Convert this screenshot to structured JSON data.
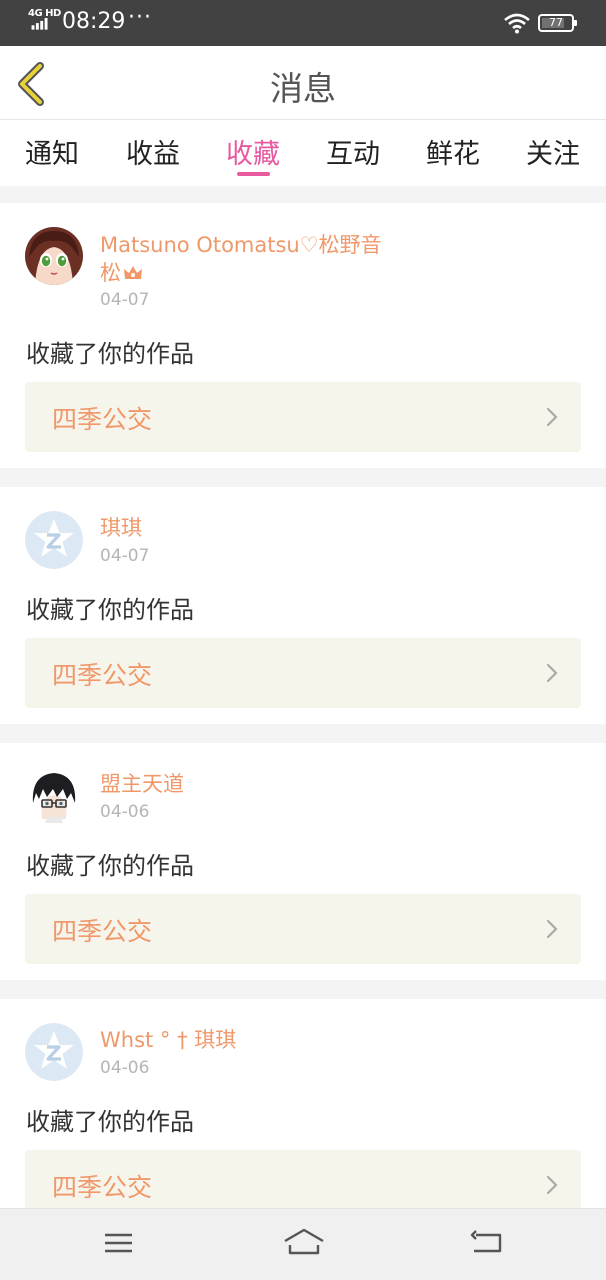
{
  "status_bar": {
    "network": "4G HD",
    "time": "08:29",
    "more": "···",
    "battery": "77",
    "battery_level": 0.77
  },
  "header": {
    "title": "消息",
    "back_icon": "chevron-left-icon"
  },
  "tabs": [
    {
      "label": "通知"
    },
    {
      "label": "收益"
    },
    {
      "label": "收藏",
      "active": true
    },
    {
      "label": "互动"
    },
    {
      "label": "鲜花"
    },
    {
      "label": "关注"
    }
  ],
  "messages": [
    {
      "user": "Matsuno Otomatsu♡松野音松",
      "badge_icon": "crown-icon",
      "date": "04-07",
      "action": "收藏了你的作品",
      "work": "四季公交",
      "avatar": "anime-girl-avatar"
    },
    {
      "user": "琪琪",
      "date": "04-07",
      "action": "收藏了你的作品",
      "work": "四季公交",
      "avatar": "default-star-avatar"
    },
    {
      "user": "盟主天道",
      "date": "04-06",
      "action": "收藏了你的作品",
      "work": "四季公交",
      "avatar": "glasses-boy-avatar"
    },
    {
      "user": "Whst ° † 琪琪",
      "date": "04-06",
      "action": "收藏了你的作品",
      "work": "四季公交",
      "avatar": "default-star-avatar"
    }
  ],
  "colors": {
    "accent": "#e85aa0",
    "username": "#f0986a",
    "work_bg": "#f6f5ec",
    "status_bar": "#424242"
  },
  "system_nav": {
    "menu_icon": "menu-icon",
    "home_icon": "home-icon",
    "back_icon": "back-icon"
  }
}
